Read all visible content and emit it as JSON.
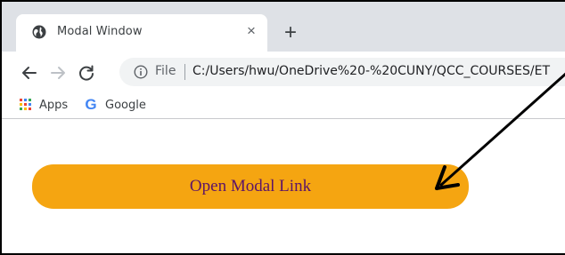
{
  "browser": {
    "tab": {
      "title": "Modal Window",
      "close_glyph": "×",
      "icon": "globe-icon"
    },
    "new_tab_glyph": "+",
    "toolbar": {
      "back_icon": "back-arrow-icon",
      "forward_icon": "forward-arrow-icon",
      "reload_icon": "reload-icon",
      "info_icon": "info-icon",
      "scheme_label": "File",
      "url": "C:/Users/hwu/OneDrive%20-%20CUNY/QCC_COURSES/ET"
    },
    "bookmarks": [
      {
        "label": "Apps",
        "icon": "apps-grid-icon"
      },
      {
        "label": "Google",
        "icon": "google-g-icon"
      }
    ]
  },
  "page": {
    "open_modal_button": "Open Modal Link"
  },
  "colors": {
    "button_bg": "#f5a511",
    "button_text": "#5c1468",
    "tabstrip_bg": "#dee1e6",
    "annotation_arrow": "#000000"
  }
}
